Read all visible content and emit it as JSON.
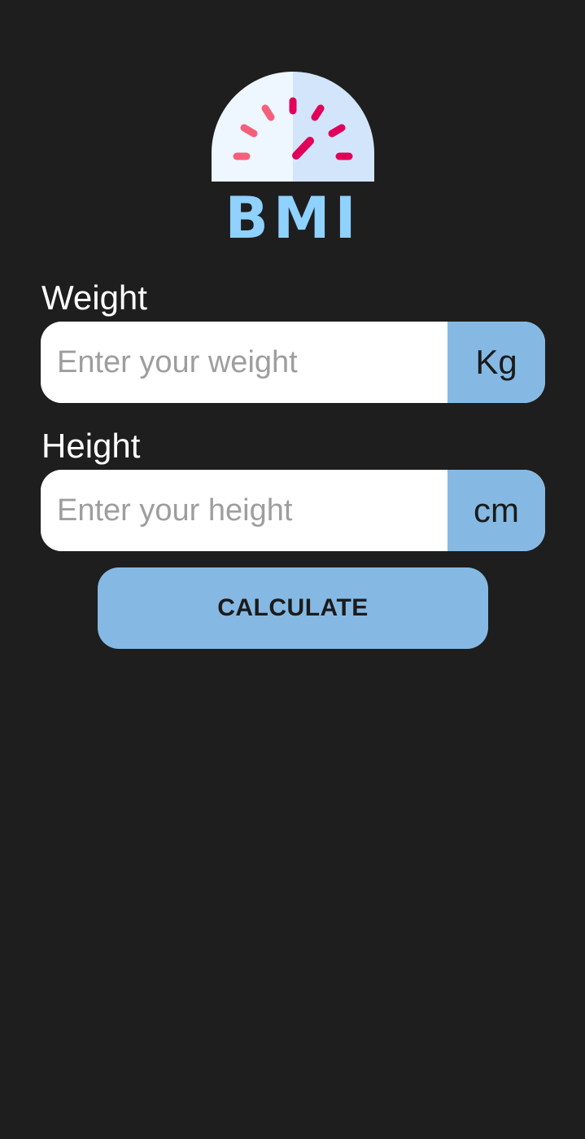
{
  "logo": {
    "icon": "bmi-gauge-icon",
    "text": "BMI",
    "colors": {
      "dial_left": "#eef6ff",
      "dial_right": "#d2e5fa",
      "tick_light": "#f4607a",
      "tick_dark": "#e0005a",
      "text": "#8fd1ff"
    }
  },
  "weight": {
    "label": "Weight",
    "placeholder": "Enter your weight",
    "value": "",
    "unit": "Kg"
  },
  "height": {
    "label": "Height",
    "placeholder": "Enter your height",
    "value": "",
    "unit": "cm"
  },
  "calculate": {
    "label": "CALCULATE"
  },
  "colors": {
    "background": "#1e1e1e",
    "accent": "#85b9e3",
    "input_background": "#ffffff",
    "placeholder": "#9e9e9e",
    "label": "#ffffff"
  }
}
